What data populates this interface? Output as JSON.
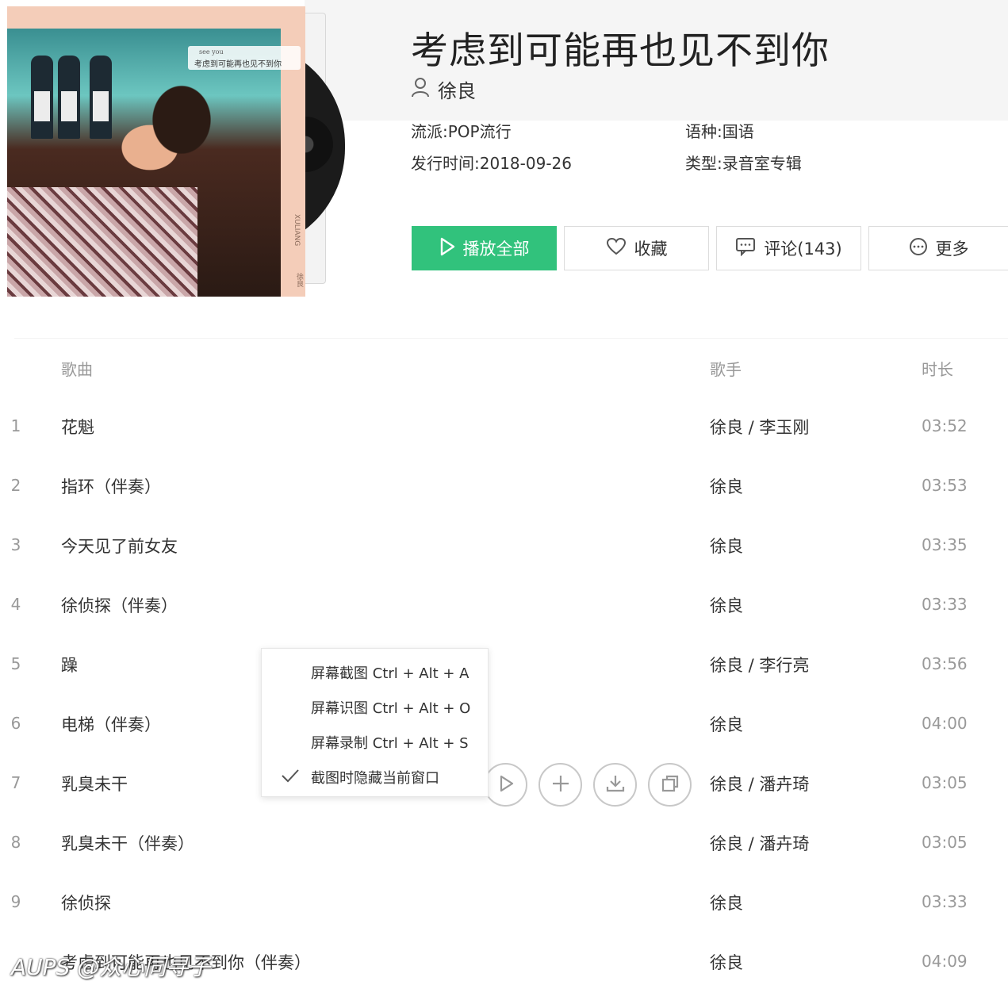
{
  "album": {
    "cover": {
      "tag_line1": "see you",
      "tag_line2": "考虑到可能再也见不到你",
      "vertical_text": "XULIANG",
      "vertical_text2": "徐良"
    },
    "title": "考虑到可能再也见不到你",
    "artist": "徐良",
    "meta": {
      "genre_label": "流派:",
      "genre": "POP流行",
      "language_label": "语种:",
      "language": "国语",
      "release_label": "发行时间:",
      "release": "2018-09-26",
      "type_label": "类型:",
      "type": "录音室专辑"
    }
  },
  "actions": {
    "play_all": "播放全部",
    "favorite": "收藏",
    "comment": "评论(143)",
    "more": "更多"
  },
  "table": {
    "headers": {
      "song": "歌曲",
      "artist": "歌手",
      "duration": "时长"
    },
    "rows": [
      {
        "num": "1",
        "song": "花魁",
        "artist": "徐良 / 李玉刚",
        "duration": "03:52"
      },
      {
        "num": "2",
        "song": "指环（伴奏）",
        "artist": "徐良",
        "duration": "03:53"
      },
      {
        "num": "3",
        "song": "今天见了前女友",
        "artist": "徐良",
        "duration": "03:35"
      },
      {
        "num": "4",
        "song": "徐侦探（伴奏）",
        "artist": "徐良",
        "duration": "03:33"
      },
      {
        "num": "5",
        "song": "躁",
        "artist": "徐良 / 李行亮",
        "duration": "03:56"
      },
      {
        "num": "6",
        "song": "电梯（伴奏）",
        "artist": "徐良",
        "duration": "04:00"
      },
      {
        "num": "7",
        "song": "乳臭未干",
        "artist": "徐良 / 潘卉琦",
        "duration": "03:05"
      },
      {
        "num": "8",
        "song": "乳臭未干（伴奏）",
        "artist": "徐良 / 潘卉琦",
        "duration": "03:05"
      },
      {
        "num": "9",
        "song": "徐侦探",
        "artist": "徐良",
        "duration": "03:33"
      },
      {
        "num": "10",
        "song": "考虑到可能再也见不到你（伴奏）",
        "artist": "徐良",
        "duration": "04:09"
      }
    ]
  },
  "context_menu": {
    "items": [
      "屏幕截图 Ctrl + Alt + A",
      "屏幕识图 Ctrl + Alt + O",
      "屏幕录制 Ctrl + Alt + S",
      "截图时隐藏当前窗口"
    ]
  },
  "watermark": "AUPS @众心同寻子",
  "colors": {
    "accent": "#31c27c",
    "muted": "#999999",
    "text": "#333333"
  }
}
